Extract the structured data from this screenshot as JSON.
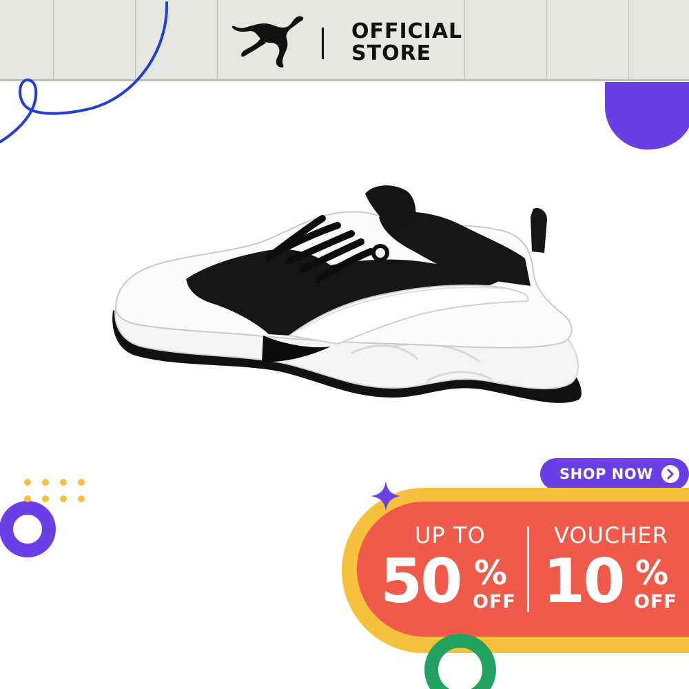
{
  "header": {
    "brand_text_line1": "OFFICIAL",
    "brand_text_line2": "STORE",
    "logo_icon": "puma-cat-icon"
  },
  "product": {
    "image": "black-white-sneaker"
  },
  "promo": {
    "shop_now_label": "SHOP NOW",
    "shop_now_icon": "chevron-right-icon",
    "left": {
      "label": "UP TO",
      "value": "50",
      "percent": "%",
      "suffix": "OFF"
    },
    "right": {
      "label": "VOUCHER",
      "value": "10",
      "percent": "%",
      "suffix": "OFF"
    }
  },
  "colors": {
    "header_bg": "#e6e6e1",
    "accent_purple": "#6c3fe6",
    "accent_blue": "#1f3fd6",
    "promo_yellow": "#f6c23e",
    "promo_red": "#f05a4a",
    "accent_green": "#21a35f"
  }
}
